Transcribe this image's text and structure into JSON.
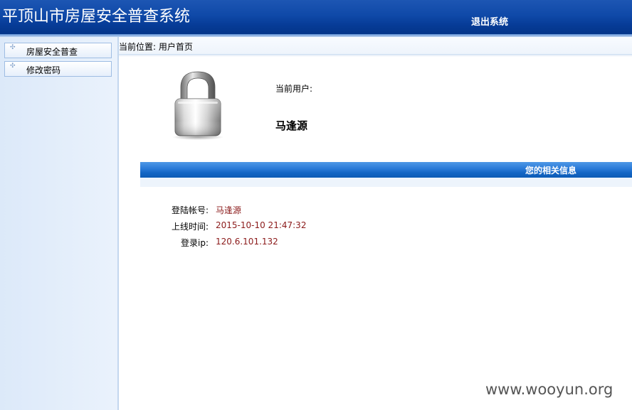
{
  "header": {
    "title": "平顶山市房屋安全普查系统",
    "logout_label": "退出系统"
  },
  "sidebar": {
    "items": [
      {
        "label": "房屋安全普查",
        "bullet": "✣"
      },
      {
        "label": "修改密码",
        "bullet": "✣"
      }
    ]
  },
  "breadcrumb": {
    "text": "当前位置: 用户首页"
  },
  "user_panel": {
    "icon": "lock-icon",
    "current_user_label": "当前用户:",
    "current_user_name": "马逢源"
  },
  "info_section": {
    "title": "您的相关信息",
    "rows": [
      {
        "label": "登陆帐号:",
        "value": "马逢源"
      },
      {
        "label": "上线时间:",
        "value": "2015-10-10 21:47:32"
      },
      {
        "label": "登录ip:",
        "value": "120.6.101.132"
      }
    ]
  },
  "watermark": "www.wooyun.org",
  "colors": {
    "header_blue": "#0f49a8",
    "section_bar_blue": "#2c7cd9",
    "value_red": "#8b1a1a",
    "sidebar_bg": "#dce9f9"
  }
}
